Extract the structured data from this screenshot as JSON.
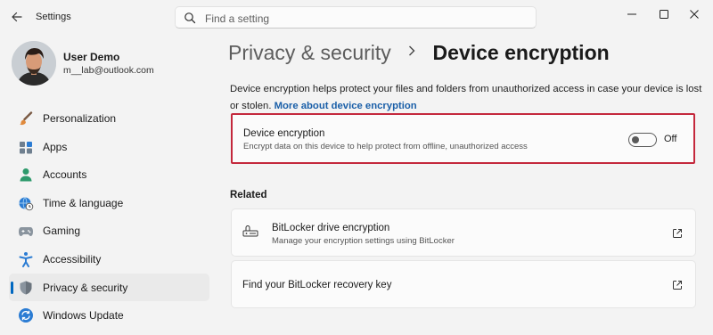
{
  "window": {
    "app_title": "Settings",
    "controls": [
      "minimize-icon",
      "maximize-icon",
      "close-icon"
    ]
  },
  "search": {
    "placeholder": "Find a setting"
  },
  "profile": {
    "name": "User Demo",
    "email": "m__lab@outlook.com"
  },
  "sidebar": {
    "items": [
      {
        "label": "Personalization",
        "icon": "paintbrush-icon"
      },
      {
        "label": "Apps",
        "icon": "apps-icon"
      },
      {
        "label": "Accounts",
        "icon": "person-icon"
      },
      {
        "label": "Time & language",
        "icon": "globe-clock-icon"
      },
      {
        "label": "Gaming",
        "icon": "gamepad-icon"
      },
      {
        "label": "Accessibility",
        "icon": "accessibility-icon"
      },
      {
        "label": "Privacy & security",
        "icon": "shield-icon",
        "selected": true
      },
      {
        "label": "Windows Update",
        "icon": "update-icon"
      }
    ]
  },
  "breadcrumb": {
    "parent": "Privacy & security",
    "current": "Device encryption"
  },
  "description": {
    "text": "Device encryption helps protect your files and folders from unauthorized access in case your device is lost or stolen. ",
    "link": "More about device encryption"
  },
  "device_encryption": {
    "title": "Device encryption",
    "subtitle": "Encrypt data on this device to help protect from offline, unauthorized access",
    "toggle_state": "Off",
    "enabled": false
  },
  "related": {
    "heading": "Related",
    "items": [
      {
        "title": "BitLocker drive encryption",
        "subtitle": "Manage your encryption settings using BitLocker",
        "icon": "bitlocker-key-icon"
      },
      {
        "title": "Find your BitLocker recovery key",
        "subtitle": ""
      }
    ]
  },
  "colors": {
    "accent": "#0067c0",
    "link": "#1a5fa8",
    "highlight_border": "#c4283c",
    "background": "#f3f3f3",
    "card": "#fbfbfb"
  }
}
